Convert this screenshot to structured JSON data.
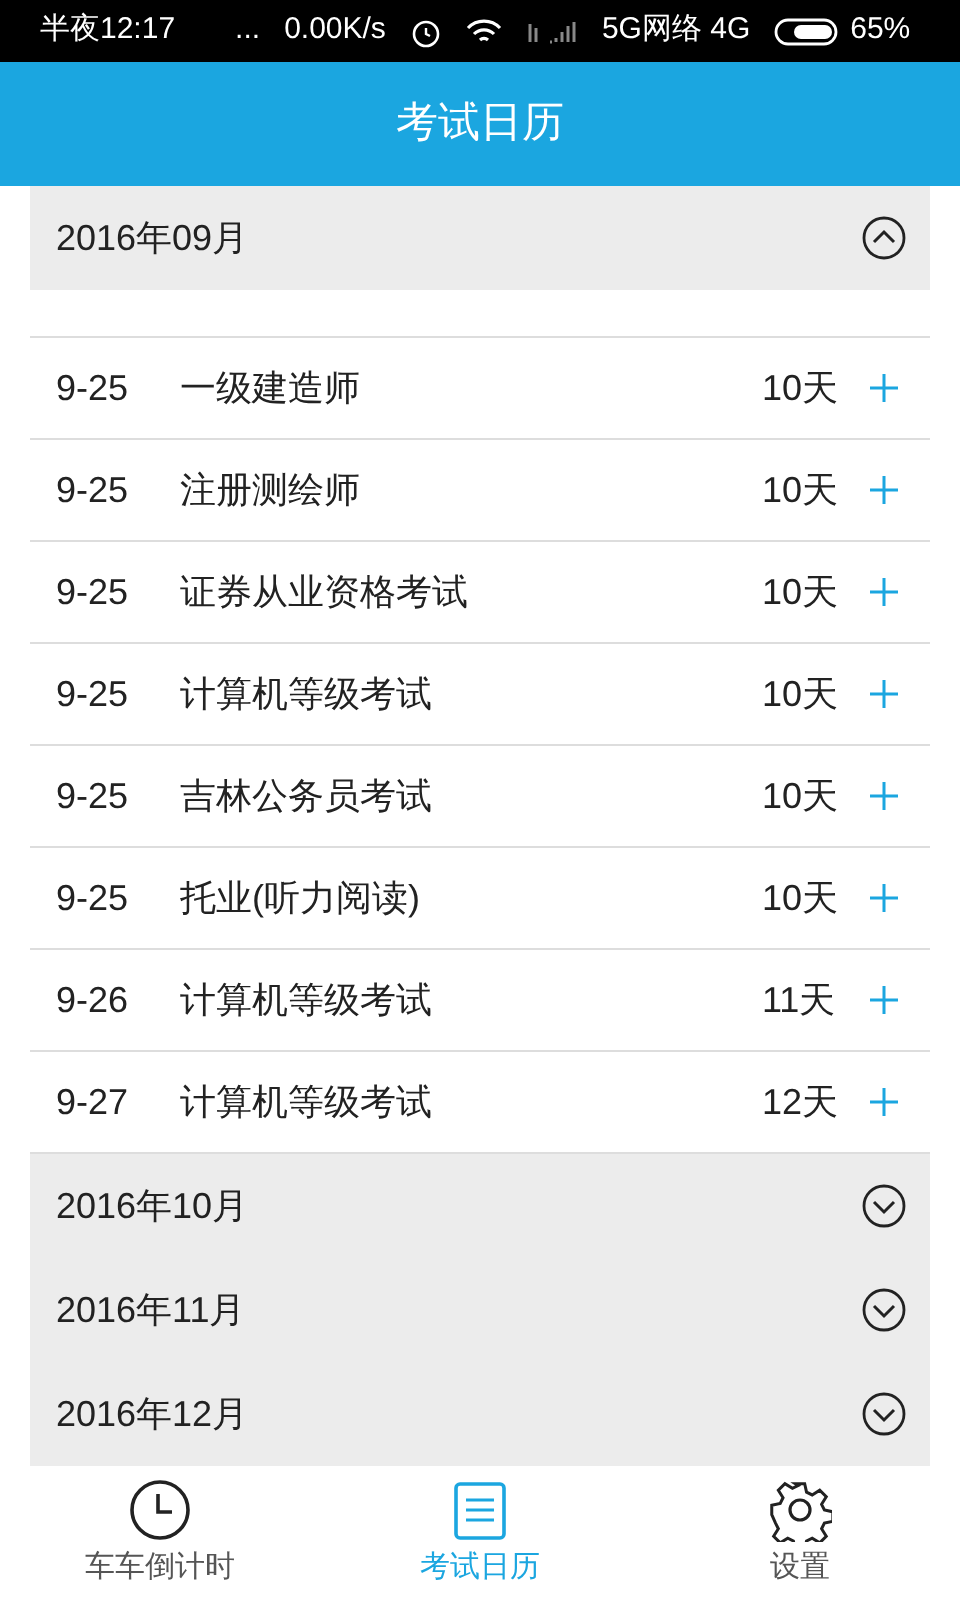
{
  "status_bar": {
    "time": "半夜12:17",
    "dots": "...",
    "speed": "0.00K/s",
    "network": "5G网络 4G",
    "battery": "65%"
  },
  "header": {
    "title": "考试日历"
  },
  "months": [
    {
      "label": "2016年09月",
      "expanded": true,
      "items": [
        {
          "date": "9-25",
          "name": "一级建造师",
          "days": "10天"
        },
        {
          "date": "9-25",
          "name": "注册测绘师",
          "days": "10天"
        },
        {
          "date": "9-25",
          "name": "证券从业资格考试",
          "days": "10天"
        },
        {
          "date": "9-25",
          "name": "计算机等级考试",
          "days": "10天"
        },
        {
          "date": "9-25",
          "name": "吉林公务员考试",
          "days": "10天"
        },
        {
          "date": "9-25",
          "name": "托业(听力阅读)",
          "days": "10天"
        },
        {
          "date": "9-26",
          "name": "计算机等级考试",
          "days": "11天"
        },
        {
          "date": "9-27",
          "name": "计算机等级考试",
          "days": "12天"
        }
      ]
    },
    {
      "label": "2016年10月",
      "expanded": false
    },
    {
      "label": "2016年11月",
      "expanded": false
    },
    {
      "label": "2016年12月",
      "expanded": false
    }
  ],
  "tabs": [
    {
      "kind": "clock",
      "label": "车车倒计时",
      "selected": false
    },
    {
      "kind": "calendar",
      "label": "考试日历",
      "selected": true
    },
    {
      "kind": "gear",
      "label": "设置",
      "selected": false
    }
  ]
}
